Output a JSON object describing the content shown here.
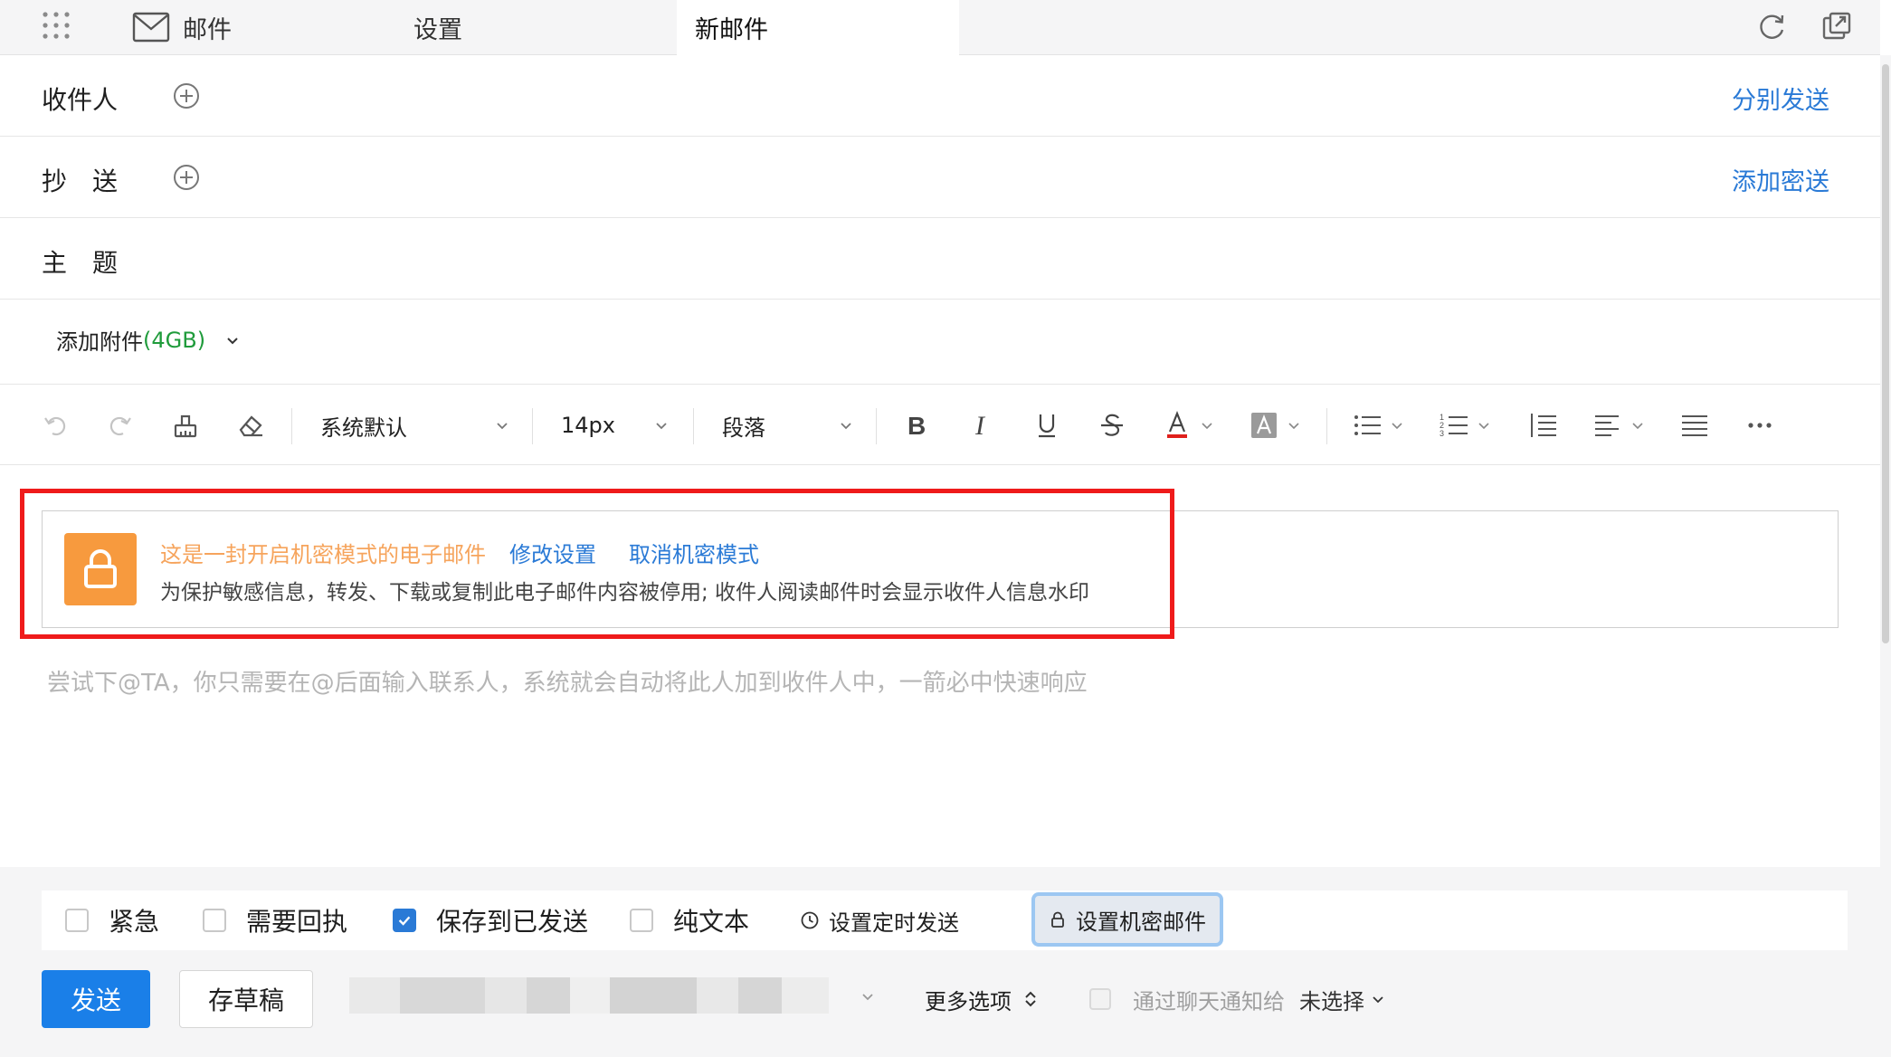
{
  "tabs": {
    "mail": "邮件",
    "settings": "设置",
    "compose": "新邮件"
  },
  "header": {
    "to_label": "收件人",
    "cc_label": "抄　送",
    "subject_label": "主　题",
    "send_separately": "分别发送",
    "add_bcc": "添加密送"
  },
  "attachment": {
    "label": "添加附件",
    "size": "(4GB)"
  },
  "toolbar": {
    "font": "系统默认",
    "size": "14px",
    "paragraph": "段落"
  },
  "banner": {
    "title": "这是一封开启机密模式的电子邮件",
    "modify": "修改设置",
    "cancel": "取消机密模式",
    "desc": "为保护敏感信息，转发、下载或复制此电子邮件内容被停用; 收件人阅读邮件时会显示收件人信息水印"
  },
  "body_hint": "尝试下@TA，你只需要在@后面输入联系人，系统就会自动将此人加到收件人中，一箭必中快速响应",
  "options": {
    "urgent": "紧急",
    "receipt": "需要回执",
    "save_sent": "保存到已发送",
    "save_sent_checked": true,
    "plain_text": "纯文本",
    "schedule": "设置定时发送",
    "confidential": "设置机密邮件"
  },
  "footer": {
    "send": "发送",
    "draft": "存草稿",
    "more": "更多选项",
    "notify_label": "通过聊天通知给",
    "notify_value": "未选择"
  },
  "colors": {
    "accent": "#1a7fe8",
    "link": "#2a7ad6",
    "lock": "#f79a3e",
    "highlight": "#ef1b1b",
    "size_green": "#1f9b3b"
  }
}
